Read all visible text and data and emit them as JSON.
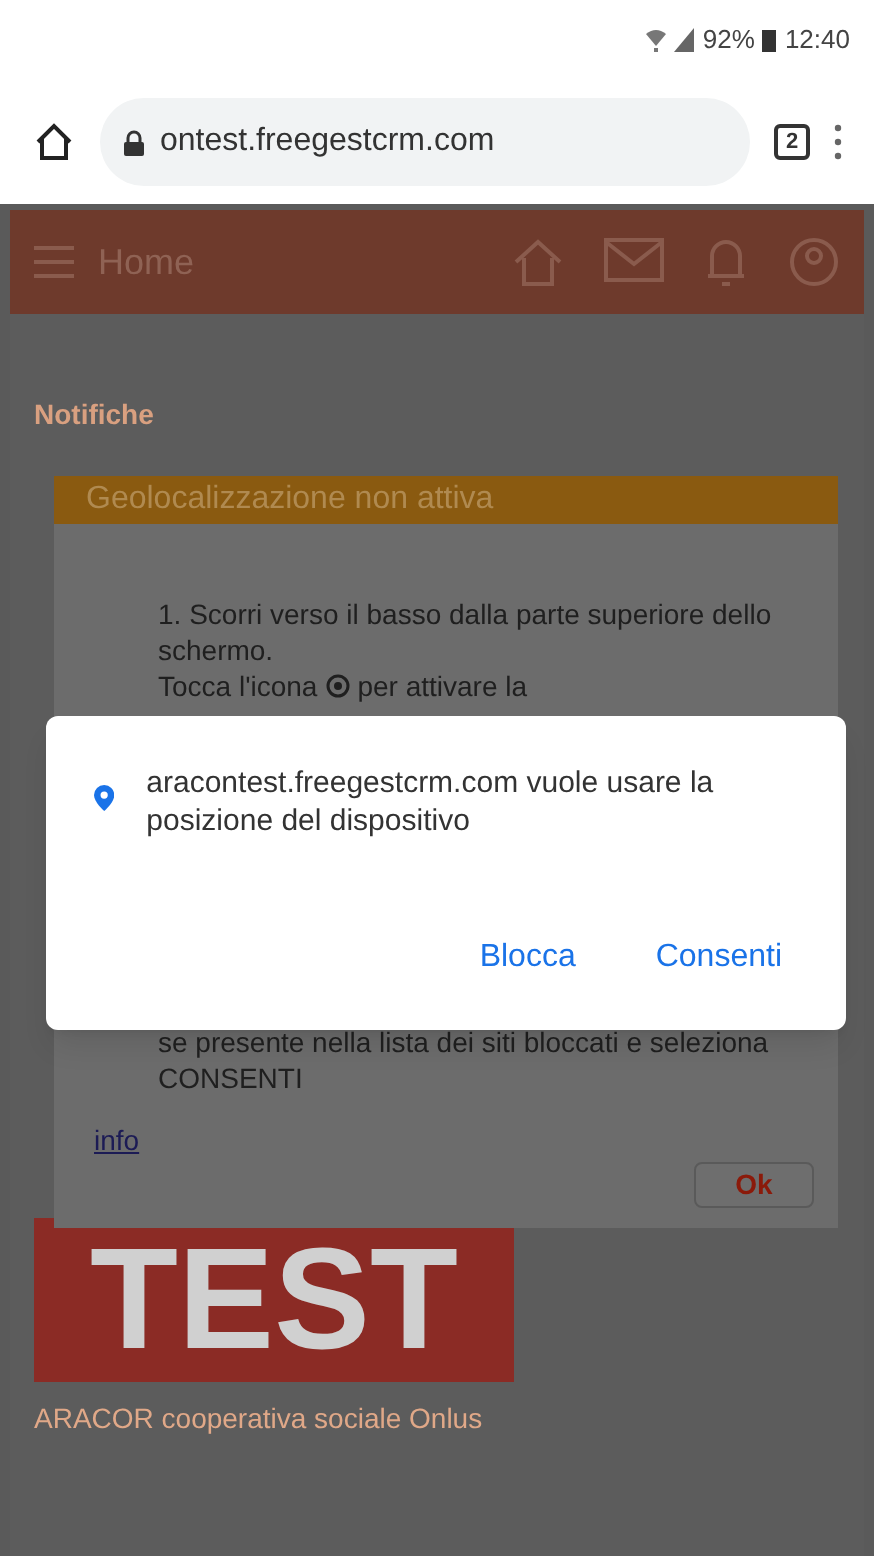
{
  "status_bar": {
    "battery": "92%",
    "time": "12:40"
  },
  "browser": {
    "url": "ontest.freegestcrm.com",
    "tab_count": "2"
  },
  "app_header": {
    "title": "Home"
  },
  "page": {
    "section_title": "Notifiche",
    "logo_text": "TEST",
    "org_name": "ARACOR cooperativa sociale Onlus"
  },
  "geo_modal": {
    "title": "Geolocalizzazione non attiva",
    "step": "1. Scorri verso il basso dalla parte superiore dello schermo.",
    "tap_before": "Tocca l'icona",
    "tap_after": "per attivare la",
    "hint": "se presente nella lista dei siti bloccati e seleziona CONSENTI",
    "link": "info",
    "button": "Ok"
  },
  "permission_dialog": {
    "message": "aracontest.freegestcrm.com vuole usare la posizione del dispositivo",
    "buttons": [
      "Blocca",
      "Consenti"
    ]
  }
}
